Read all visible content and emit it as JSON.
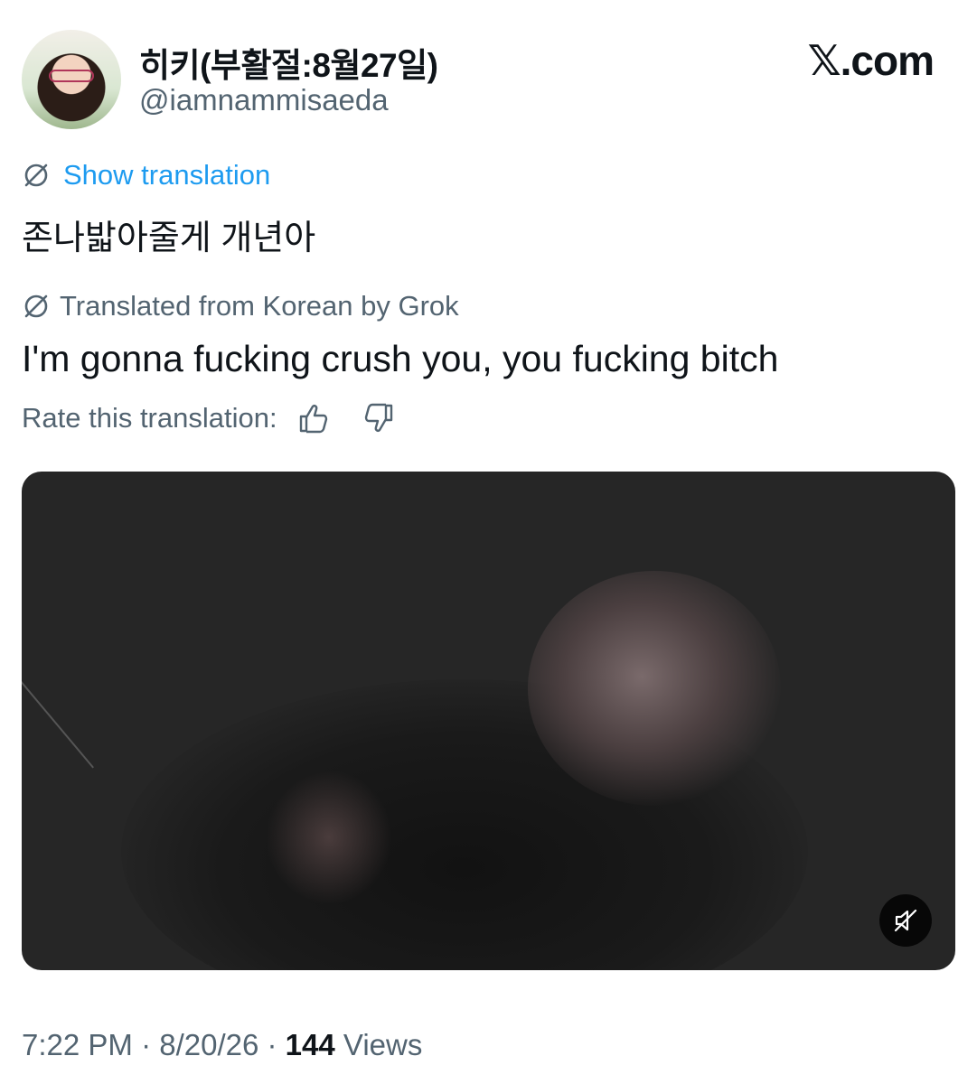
{
  "author": {
    "display_name": "히키(부활절:8월27일)",
    "handle": "@iamnammisaeda"
  },
  "brand": "𝕏.com",
  "show_translation_label": "Show translation",
  "original_text": "존나밟아줄게 개년아",
  "translated_from_label": "Translated from Korean by Grok",
  "translated_text": "I'm gonna fucking crush you, you fucking bitch",
  "rate_label": "Rate this translation:",
  "icons": {
    "translate": "translate-icon",
    "thumbs_up": "thumbs-up-icon",
    "thumbs_down": "thumbs-down-icon",
    "mute": "muted-speaker-icon"
  },
  "meta": {
    "time": "7:22 PM",
    "separator": " · ",
    "date": "8/20/26",
    "views_count": "144",
    "views_label": "Views"
  },
  "colors": {
    "link": "#1d9bf0",
    "secondary": "#536471",
    "primary": "#0f1419"
  }
}
